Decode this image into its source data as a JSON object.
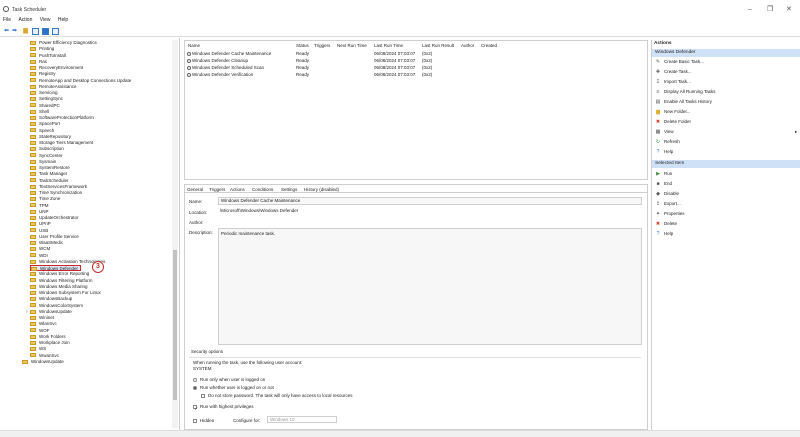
{
  "window": {
    "title": "Task Scheduler",
    "min": "–",
    "restore": "❐",
    "close": "✕"
  },
  "menu": [
    "File",
    "Action",
    "View",
    "Help"
  ],
  "tree": {
    "items": [
      "Power Efficiency Diagnostics",
      "Printing",
      "PushToInstall",
      "Ras",
      "RecoveryEnvironment",
      "Registry",
      "RemoteApp and Desktop Connections Update",
      "RemoteAssistance",
      "Servicing",
      "SettingSync",
      "SharedPC",
      "Shell",
      "SoftwareProtectionPlatform",
      "SpacePort",
      "Speech",
      "StateRepository",
      "Storage Tiers Management",
      "Subscription",
      "SyncCenter",
      "Sysmain",
      "SystemRestore",
      "Task Manager",
      "TaskScheduler",
      "TextServicesFramework",
      "Time Synchronization",
      "Time Zone",
      "TPM",
      "UNP",
      "UpdateOrchestrator",
      "UPnP",
      "USB",
      "User Profile Service",
      "WaaSMedic",
      "WCM",
      "WDI",
      "Windows Activation Technologies",
      "Windows Defender",
      "Windows Error Reporting",
      "Windows Filtering Platform",
      "Windows Media Sharing",
      "Windows Subsystem For Linux",
      "WindowsBackup",
      "WindowsColorSystem",
      "WindowsUpdate",
      "Wininet",
      "WlanSvc",
      "WOF",
      "Work Folders",
      "Workplace Join",
      "WS",
      "WwanSvc"
    ],
    "last_item": "WindowsUpdate",
    "selected_badge": "3"
  },
  "tasks": {
    "columns": [
      "Name",
      "Status",
      "Triggers",
      "Next Run Time",
      "Last Run Time",
      "Last Run Result",
      "Author",
      "Created"
    ],
    "rows": [
      {
        "name": "Windows Defender Cache Maintenance",
        "status": "Ready",
        "last_run": "06/08/2024 07:03:07",
        "result": "(0x2)"
      },
      {
        "name": "Windows Defender Cleanup",
        "status": "Ready",
        "last_run": "06/08/2024 07:03:07",
        "result": "(0x2)"
      },
      {
        "name": "Windows Defender Scheduled Scan",
        "status": "Ready",
        "last_run": "06/08/2024 07:03:07",
        "result": "(0x2)"
      },
      {
        "name": "Windows Defender Verification",
        "status": "Ready",
        "last_run": "06/08/2024 07:03:07",
        "result": "(0x2)"
      }
    ]
  },
  "details": {
    "tabs": [
      "General",
      "Triggers",
      "Actions",
      "Conditions",
      "Settings",
      "History (disabled)"
    ],
    "name_label": "Name:",
    "name_value": "Windows Defender Cache Maintenance",
    "location_label": "Location:",
    "location_value": "\\Microsoft\\Windows\\Windows Defender",
    "author_label": "Author:",
    "description_label": "Description:",
    "description_value": "Periodic maintenance task.",
    "security_title": "Security options",
    "security_text": "When running the task, use the following user account:",
    "security_account": "SYSTEM",
    "opt_logged_on": "Run only when user is logged on",
    "opt_whether": "Run whether user is logged on or not",
    "opt_no_store": "Do not store password.  The task will only have access to local resources",
    "opt_highest": "Run with highest privileges",
    "hidden_label": "Hidden",
    "configure_label": "Configure for:",
    "configure_value": "Windows 10"
  },
  "actions": {
    "header": "Actions",
    "section1": "Windows Defender",
    "items1": [
      {
        "label": "Create Basic Task...",
        "icon": "wand-icon"
      },
      {
        "label": "Create Task...",
        "icon": "task-icon"
      },
      {
        "label": "Import Task...",
        "icon": "import-icon"
      },
      {
        "label": "Display All Running Tasks",
        "icon": "list-icon"
      },
      {
        "label": "Enable All Tasks History",
        "icon": "history-icon"
      },
      {
        "label": "New Folder...",
        "icon": "folder-icon"
      },
      {
        "label": "Delete Folder",
        "icon": "delete-icon"
      },
      {
        "label": "View",
        "icon": "view-icon"
      },
      {
        "label": "Refresh",
        "icon": "refresh-icon"
      },
      {
        "label": "Help",
        "icon": "help-icon"
      }
    ],
    "section2": "Selected Item",
    "items2": [
      {
        "label": "Run",
        "icon": "run-icon"
      },
      {
        "label": "End",
        "icon": "end-icon"
      },
      {
        "label": "Disable",
        "icon": "disable-icon"
      },
      {
        "label": "Export...",
        "icon": "export-icon"
      },
      {
        "label": "Properties",
        "icon": "properties-icon"
      },
      {
        "label": "Delete",
        "icon": "delete-icon"
      },
      {
        "label": "Help",
        "icon": "help-icon"
      }
    ]
  }
}
